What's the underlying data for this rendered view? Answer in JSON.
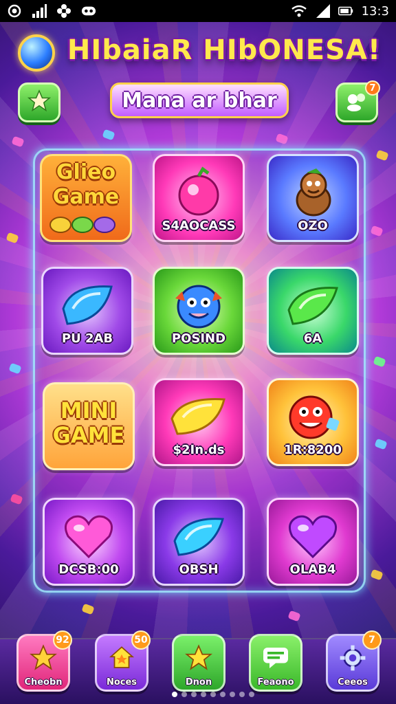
{
  "status_bar": {
    "time": "13:3"
  },
  "header": {
    "title": "HIbaiaR HIbONESA!",
    "subtitle": "Mana ar bhar",
    "right_button_badge": "7"
  },
  "tiles": [
    {
      "label": "",
      "big_text": "Glieo Game",
      "style": "orange"
    },
    {
      "label": "S4AOCASS",
      "style": "pink",
      "icon": "berry-icon"
    },
    {
      "label": "OZO",
      "style": "blue",
      "icon": "squirrel-icon"
    },
    {
      "label": "PU 2AB",
      "style": "purple",
      "icon": "blue-gem-icon"
    },
    {
      "label": "POSIND",
      "style": "green",
      "icon": "blue-creature-icon"
    },
    {
      "label": "6A",
      "style": "green-teal",
      "icon": "green-gem-icon"
    },
    {
      "label": "",
      "big_text": "MINI GAME",
      "style": "orange-gold"
    },
    {
      "label": "$2In.ds",
      "style": "magenta",
      "icon": "yellow-gem-icon"
    },
    {
      "label": "1R:8200",
      "style": "gold",
      "icon": "red-creature-icon"
    },
    {
      "label": "DCSB:00",
      "style": "violet",
      "icon": "pink-heart-icon"
    },
    {
      "label": "OBSH",
      "style": "violet-deep",
      "icon": "blue-gem-icon"
    },
    {
      "label": "OLAB4",
      "style": "magenta-deep",
      "icon": "purple-heart-icon"
    }
  ],
  "bottom_nav": [
    {
      "label": "Cheobn",
      "badge": "92",
      "icon": "star-icon",
      "color": "#ff4fa0"
    },
    {
      "label": "Noces",
      "badge": "50",
      "icon": "house-star-icon",
      "color": "#9a3ad8"
    },
    {
      "label": "Dnon",
      "badge": "",
      "icon": "star-icon",
      "color": "#3ac24a"
    },
    {
      "label": "Feaono",
      "badge": "",
      "icon": "chat-icon",
      "color": "#4ac83a"
    },
    {
      "label": "Ceeos",
      "badge": "7",
      "icon": "gear-icon",
      "color": "#7a4ae8"
    }
  ]
}
